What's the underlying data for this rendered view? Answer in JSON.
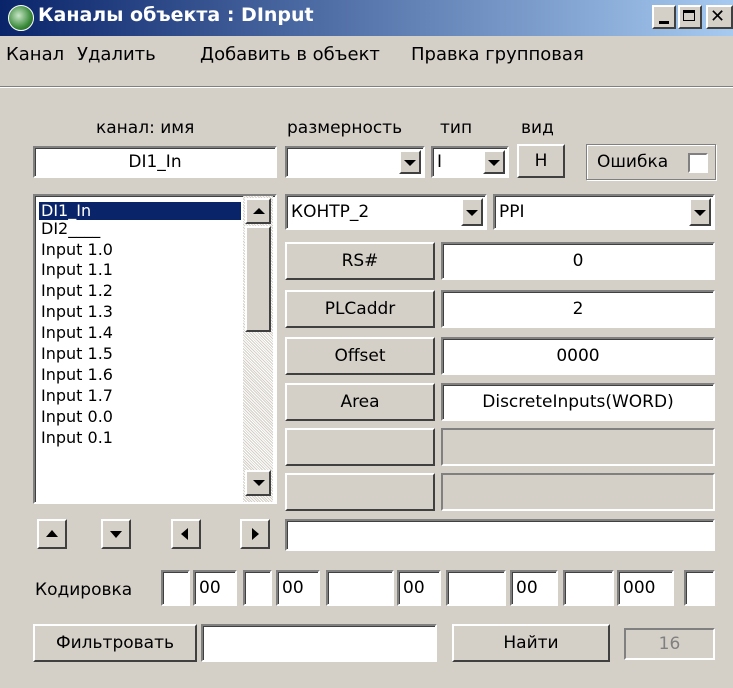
{
  "window": {
    "title": "Каналы объекта : DInput"
  },
  "menu": [
    "Канал",
    "Удалить",
    "Добавить в объект",
    "Правка групповая"
  ],
  "headers": {
    "channel_name": "канал: имя",
    "dimension": "размерность",
    "type": "тип",
    "view": "вид"
  },
  "channel_name_value": "DI1_In",
  "dimension_value": "",
  "type_value": "I",
  "view_button": "Н",
  "error_label": "Ошибка",
  "channels": [
    "DI1_In",
    "DI2____",
    "Input 1.0",
    "Input 1.1",
    "Input 1.2",
    "Input 1.3",
    "Input 1.4",
    "Input 1.5",
    "Input 1.6",
    "Input 1.7",
    "Input 0.0",
    "Input 0.1"
  ],
  "selected_channel": "DI1_In",
  "controller_value": "КОНТР_2",
  "protocol_value": "PPI",
  "params": [
    {
      "label": "RS#",
      "value": "0"
    },
    {
      "label": "PLCaddr",
      "value": "2"
    },
    {
      "label": "Offset",
      "value": "0000"
    },
    {
      "label": "Area",
      "value": "DiscreteInputs(WORD)"
    },
    {
      "label": "",
      "value": ""
    },
    {
      "label": "",
      "value": ""
    }
  ],
  "nav_buttons": [
    "arrow-up-icon",
    "arrow-down-icon",
    "arrow-left-icon",
    "arrow-right-icon"
  ],
  "info_field": "",
  "encoding": {
    "label": "Кодировка",
    "fields": [
      "",
      "00",
      "",
      "00",
      "",
      "00",
      "",
      "00",
      "",
      "000",
      ""
    ]
  },
  "filter_button": "Фильтровать",
  "filter_value": "",
  "find_button": "Найти",
  "count": "16"
}
